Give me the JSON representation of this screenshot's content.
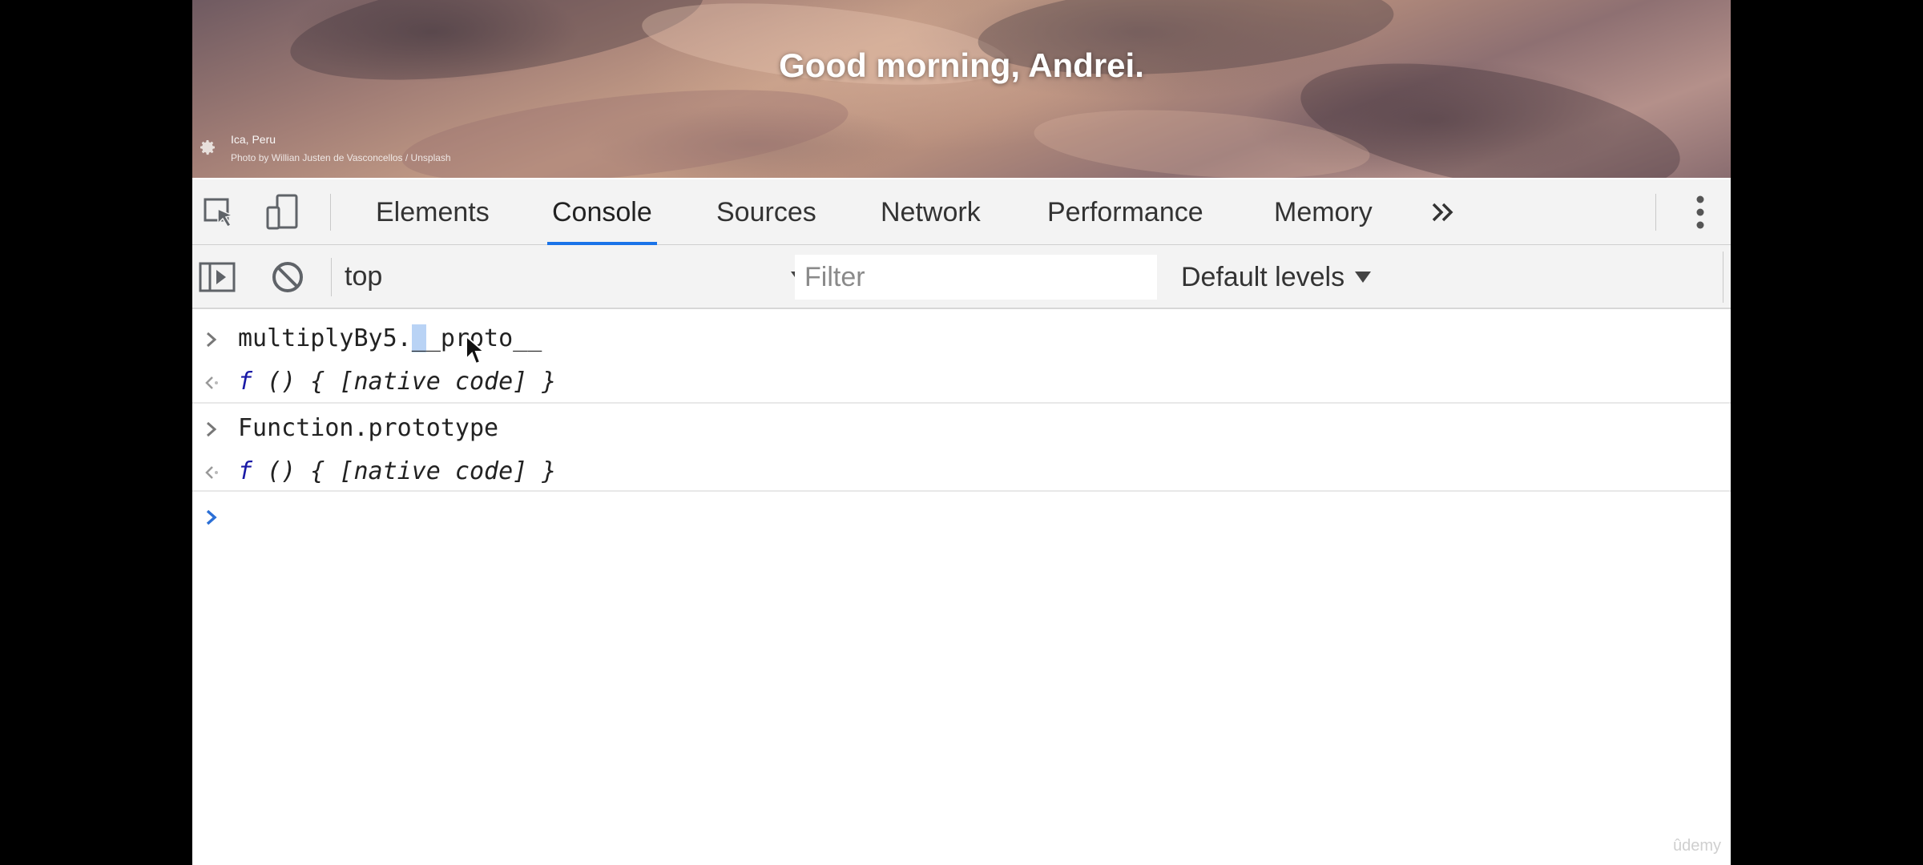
{
  "hero": {
    "greeting": "Good morning, Andrei.",
    "location": "Ica, Peru",
    "credit": "Photo by Willian Justen de Vasconcellos / Unsplash"
  },
  "devtools": {
    "tabs": [
      "Elements",
      "Console",
      "Sources",
      "Network",
      "Performance",
      "Memory"
    ],
    "active_tab": "Console",
    "overflow_icon": "chevrons-right-icon",
    "accent_color": "#1a73e8"
  },
  "toolbar": {
    "context": "top",
    "filter_placeholder": "Filter",
    "levels_label": "Default levels"
  },
  "console": {
    "entries": [
      {
        "input_pre": "multiplyBy5.",
        "input_sel": "_",
        "input_post": "_proto__",
        "result_kw": "f",
        "result_rest": " () { [native code] }"
      },
      {
        "input": "Function.prototype",
        "result_kw": "f",
        "result_rest": " () { [native code] }"
      }
    ]
  },
  "watermark": "ûdemy"
}
